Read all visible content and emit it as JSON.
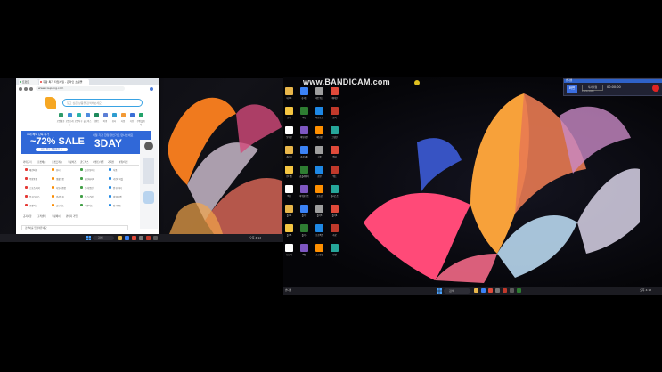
{
  "left_browser": {
    "tabs": [
      "트렌드",
      "쿠팡 특가 타임세일 - 온라인 쇼핑몰"
    ],
    "address": "www.coupang.com",
    "search_placeholder": "찾고 싶은 상품을 검색해보세요!",
    "quick_icons": [
      "로켓배송",
      "로켓프레시",
      "로켓직구",
      "골드박스",
      "이벤트",
      "여행",
      "뷰티",
      "식품",
      "가전",
      "쿠팡플레이"
    ],
    "banner": {
      "left_caption": "최대 혜택 단독 특가",
      "sale_text": "~72% SALE",
      "button_label": "지금 바로 쇼핑하기 >",
      "right_caption": "세일 기간 한정 할인가로 만나보세요",
      "right_text": "3DAY"
    },
    "menu": [
      "카테고리",
      "로켓배송",
      "로켓프레시",
      "쿠팡비즈",
      "골드박스",
      "이벤트/쿠폰",
      "기획전",
      "여행/티켓"
    ],
    "grid_rows": [
      [
        "패션의류",
        "뷰티",
        "출산/유아동",
        "식품"
      ],
      [
        "주방용품",
        "생활용품",
        "홈인테리어",
        "가전디지털"
      ],
      [
        "스포츠/레저",
        "자동차용품",
        "도서/음반",
        "완구/취미"
      ],
      [
        "문구/오피스",
        "반려동물",
        "헬스/건강",
        "여행/티켓"
      ],
      [
        "로켓직구",
        "골드박스",
        "쿠팡비즈",
        "정기배송"
      ]
    ],
    "bottom_links": [
      "공지사항",
      "고객센터",
      "쿠팡페이",
      "판매자 가입"
    ],
    "bottom_bar": "검색어를 입력해주세요"
  },
  "left_taskbar": {
    "search": "검색",
    "tray": "오후 4:12"
  },
  "right_desktop": {
    "watermark": "www.BANDICAM.com",
    "recorder": {
      "title": "반디캠",
      "mode": "화면",
      "mode_label": "직사각형",
      "size": "1920x1080",
      "timer": "00:00:00"
    },
    "desktop_icons": [
      "내 PC",
      "휴지통",
      "네트워크",
      "제어판",
      "문서",
      "사진",
      "다운로드",
      "음악",
      "동영상",
      "바탕화면",
      "메모장",
      "그림판",
      "계산기",
      "카카오톡",
      "크롬",
      "엣지",
      "반디캠",
      "곰플레이어",
      "한글",
      "워드",
      "엑셀",
      "파워포인트",
      "포토샵",
      "일러스트",
      "폴더1",
      "폴더2",
      "폴더3",
      "폴더4",
      "폴더5",
      "폴더6",
      "프로젝트",
      "자료",
      "보고서",
      "백업",
      "스크린샷",
      "영상"
    ]
  },
  "right_taskbar": {
    "app": "반디캠",
    "search": "검색",
    "tray": "오후 4:12"
  }
}
